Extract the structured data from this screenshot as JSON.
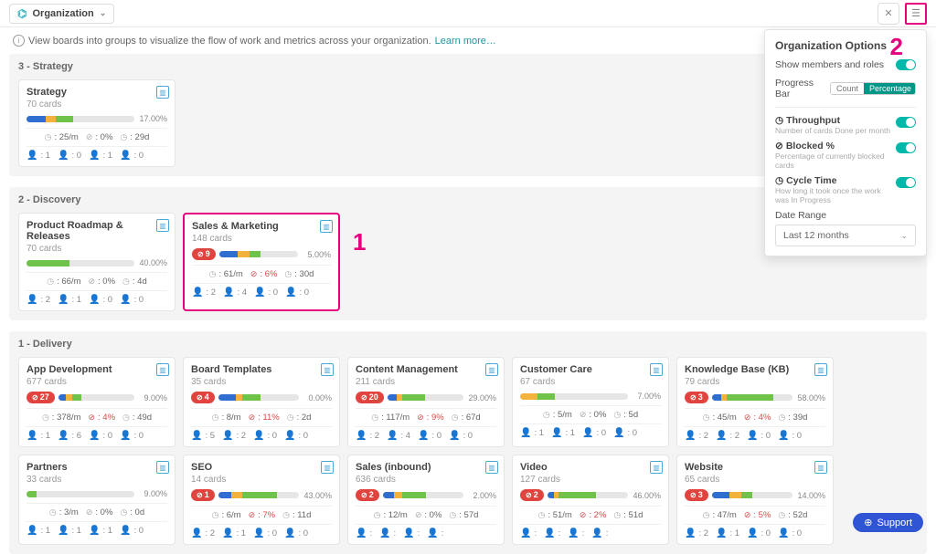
{
  "header": {
    "title": "Organization",
    "info_text": "View boards into groups to visualize the flow of work and metrics across your organization.",
    "learn_more": "Learn more…"
  },
  "panel": {
    "title": "Organization Options",
    "show_members": "Show members and roles",
    "progress_bar": "Progress Bar",
    "count": "Count",
    "percentage": "Percentage",
    "throughput": "Throughput",
    "throughput_sub": "Number of cards Done per month",
    "blocked": "Blocked %",
    "blocked_sub": "Percentage of currently blocked cards",
    "cycle": "Cycle Time",
    "cycle_sub": "How long it took once the work was In Progress",
    "date_range": "Date Range",
    "range_value": "Last 12 months"
  },
  "groups": [
    {
      "title": "3 - Strategy",
      "cards": [
        {
          "name": "Strategy",
          "sub": "70 cards",
          "pct": "17.00%",
          "segs": [
            [
              "#2f6dd0",
              18
            ],
            [
              "#f3b23b",
              9
            ],
            [
              "#6fc24a",
              16
            ]
          ],
          "m1": "25/m",
          "m2": "0%",
          "m3": "29d",
          "mem": [
            "1",
            "0",
            "1",
            "0"
          ]
        }
      ]
    },
    {
      "title": "2 - Discovery",
      "cards": [
        {
          "name": "Product Roadmap & Releases",
          "sub": "70 cards",
          "pct": "40.00%",
          "segs": [
            [
              "#6fc24a",
              40
            ]
          ],
          "m1": "66/m",
          "m2": "0%",
          "m3": "4d",
          "mem": [
            "2",
            "1",
            "0",
            "0"
          ]
        },
        {
          "name": "Sales & Marketing",
          "sub": "148 cards",
          "pct": "5.00%",
          "badge": "9",
          "hl": true,
          "segs": [
            [
              "#2f6dd0",
              24
            ],
            [
              "#f3b23b",
              14
            ],
            [
              "#6fc24a",
              14
            ]
          ],
          "m1": "61/m",
          "m2": "6%",
          "m2red": true,
          "m3": "30d",
          "mem": [
            "2",
            "4",
            "0",
            "0"
          ]
        }
      ]
    },
    {
      "title": "1 - Delivery",
      "cards": [
        {
          "name": "App Development",
          "sub": "677 cards",
          "pct": "9.00%",
          "badge": "27",
          "segs": [
            [
              "#2f6dd0",
              10
            ],
            [
              "#f3b23b",
              8
            ],
            [
              "#6fc24a",
              12
            ]
          ],
          "m1": "378/m",
          "m2": "4%",
          "m2red": true,
          "m3": "49d",
          "mem": [
            "1",
            "6",
            "0",
            "0"
          ]
        },
        {
          "name": "Board Templates",
          "sub": "35 cards",
          "pct": "0.00%",
          "badge": "4",
          "segs": [
            [
              "#2f6dd0",
              22
            ],
            [
              "#f3b23b",
              8
            ],
            [
              "#6fc24a",
              22
            ]
          ],
          "m1": "8/m",
          "m2": "11%",
          "m2red": true,
          "m3": "2d",
          "mem": [
            "5",
            "2",
            "0",
            "0"
          ]
        },
        {
          "name": "Content Management",
          "sub": "211 cards",
          "pct": "29.00%",
          "badge": "20",
          "segs": [
            [
              "#2f6dd0",
              12
            ],
            [
              "#f3b23b",
              8
            ],
            [
              "#6fc24a",
              30
            ]
          ],
          "m1": "117/m",
          "m2": "9%",
          "m2red": true,
          "m3": "67d",
          "mem": [
            "2",
            "4",
            "0",
            "0"
          ]
        },
        {
          "name": "Customer Care",
          "sub": "67 cards",
          "pct": "7.00%",
          "segs": [
            [
              "#f3b23b",
              16
            ],
            [
              "#6fc24a",
              16
            ]
          ],
          "m1": "5/m",
          "m2": "0%",
          "m3": "5d",
          "mem": [
            "1",
            "1",
            "0",
            "0"
          ]
        },
        {
          "name": "Knowledge Base (KB)",
          "sub": "79 cards",
          "pct": "58.00%",
          "badge": "3",
          "segs": [
            [
              "#2f6dd0",
              12
            ],
            [
              "#f3b23b",
              6
            ],
            [
              "#6fc24a",
              58
            ]
          ],
          "m1": "45/m",
          "m2": "4%",
          "m2red": true,
          "m3": "39d",
          "mem": [
            "2",
            "2",
            "0",
            "0"
          ]
        },
        {
          "name": "Partners",
          "sub": "33 cards",
          "pct": "9.00%",
          "segs": [
            [
              "#6fc24a",
              9
            ]
          ],
          "m1": "3/m",
          "m2": "0%",
          "m3": "0d",
          "mem": [
            "1",
            "1",
            "1",
            "0"
          ]
        },
        {
          "name": "SEO",
          "sub": "14 cards",
          "pct": "43.00%",
          "badge": "1",
          "segs": [
            [
              "#2f6dd0",
              16
            ],
            [
              "#f3b23b",
              14
            ],
            [
              "#6fc24a",
              43
            ]
          ],
          "m1": "6/m",
          "m2": "7%",
          "m2red": true,
          "m3": "11d",
          "mem": [
            "2",
            "1",
            "0",
            "0"
          ]
        },
        {
          "name": "Sales (inbound)",
          "sub": "636 cards",
          "pct": "2.00%",
          "badge": "2",
          "segs": [
            [
              "#2f6dd0",
              14
            ],
            [
              "#f3b23b",
              10
            ],
            [
              "#6fc24a",
              30
            ]
          ],
          "m1": "12/m",
          "m2": "0%",
          "m3": "57d",
          "mem": [
            "",
            "",
            "",
            ""
          ]
        },
        {
          "name": "Video",
          "sub": "127 cards",
          "pct": "46.00%",
          "badge": "2",
          "segs": [
            [
              "#2f6dd0",
              8
            ],
            [
              "#f3b23b",
              6
            ],
            [
              "#6fc24a",
              46
            ]
          ],
          "m1": "51/m",
          "m2": "2%",
          "m2red": true,
          "m3": "51d",
          "mem": [
            "",
            "",
            "",
            ""
          ]
        },
        {
          "name": "Website",
          "sub": "65 cards",
          "pct": "14.00%",
          "badge": "3",
          "segs": [
            [
              "#2f6dd0",
              22
            ],
            [
              "#f3b23b",
              14
            ],
            [
              "#6fc24a",
              14
            ]
          ],
          "m1": "47/m",
          "m2": "5%",
          "m2red": true,
          "m3": "52d",
          "mem": [
            "2",
            "1",
            "0",
            "0"
          ]
        }
      ]
    }
  ],
  "support": "Support",
  "annotations": {
    "one": "1",
    "two": "2"
  }
}
